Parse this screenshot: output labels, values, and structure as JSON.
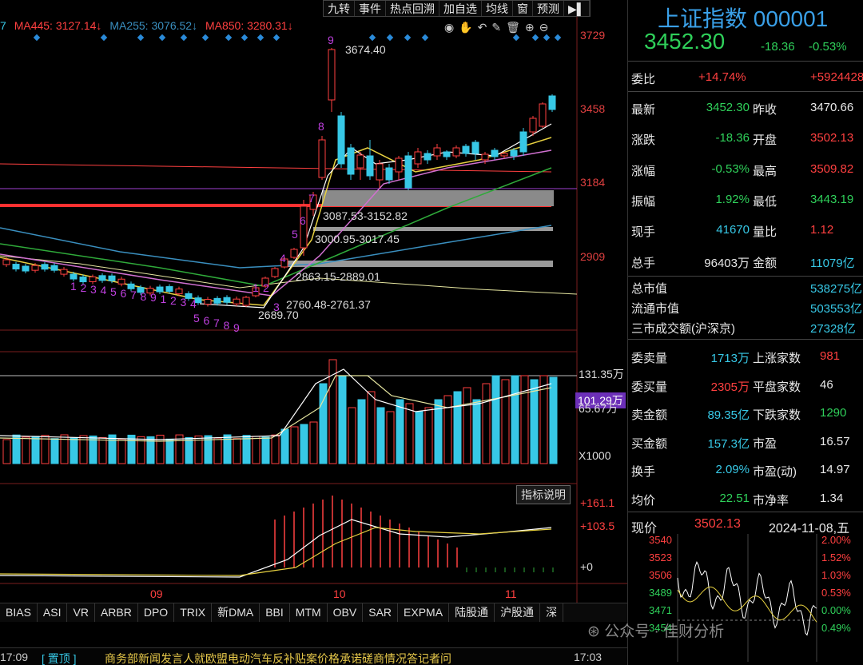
{
  "toolbar": {
    "items": [
      "九转",
      "事件",
      "热点回溯",
      "加自选",
      "均线",
      "窗",
      "预测",
      "▶▌"
    ]
  },
  "ma_legend": [
    {
      "text": "7",
      "color": "#37c8e6"
    },
    {
      "text": "MA445: 3127.14↓",
      "color": "#ff4040"
    },
    {
      "text": "MA255: 3076.52↓",
      "color": "#3a8fbf"
    },
    {
      "text": "MA850: 3280.31↓",
      "color": "#ff4040"
    }
  ],
  "price_axis": [
    "3729",
    "3458",
    "3184",
    "2909"
  ],
  "chart_annotations": {
    "high": "3674.40",
    "low": "2689.70",
    "gap1": "3087.53-3152.82",
    "gap2": "3000.95-3017.45",
    "gap3": "2863.15-2889.01",
    "gap4": "2760.48-2761.37"
  },
  "nine_turn": {
    "down1": [
      "1",
      "2",
      "3",
      "4",
      "5",
      "6",
      "7",
      "8",
      "9",
      "1",
      "2",
      "3",
      "4"
    ],
    "down2": [
      "5",
      "6",
      "7",
      "8",
      "9"
    ],
    "up": [
      "1",
      "2",
      "3",
      "4",
      "5",
      "6",
      "7",
      "8",
      "9"
    ]
  },
  "volume_axis": {
    "top": "131.35万",
    "mid": "101.29万",
    "low": "65.67万",
    "unit": "X1000"
  },
  "indicator": {
    "button": "指标说明",
    "axis": [
      "+161.1",
      "+103.5",
      "+0"
    ]
  },
  "x_axis": [
    "09",
    "10",
    "11"
  ],
  "bottom_tabs": [
    "BIAS",
    "ASI",
    "VR",
    "ARBR",
    "DPO",
    "TRIX",
    "新DMA",
    "BBI",
    "MTM",
    "OBV",
    "SAR",
    "EXPMA",
    "陆股通",
    "沪股通",
    "深"
  ],
  "status": {
    "time_left": "17:09",
    "tab": "[ 置顶 ]",
    "news": "商务部新闻发言人就欧盟电动汽车反补贴案价格承诺磋商情况答记者问",
    "time_right": "17:03"
  },
  "quote": {
    "title": "上证指数 000001",
    "price": "3452.30",
    "change": "-18.36",
    "change_pct": "-0.53%",
    "weibi_label": "委比",
    "weibi": "+14.74%",
    "weicha": "+5924428",
    "rows": [
      {
        "l1": "最新",
        "v1": "3452.30",
        "c1": "green",
        "l2": "昨收",
        "v2": "3470.66",
        "c2": "white"
      },
      {
        "l1": "涨跌",
        "v1": "-18.36",
        "c1": "green",
        "l2": "开盘",
        "v2": "3502.13",
        "c2": "red"
      },
      {
        "l1": "涨幅",
        "v1": "-0.53%",
        "c1": "green",
        "l2": "最高",
        "v2": "3509.82",
        "c2": "red"
      },
      {
        "l1": "振幅",
        "v1": "1.92%",
        "c1": "green",
        "l2": "最低",
        "v2": "3443.19",
        "c2": "green"
      },
      {
        "l1": "现手",
        "v1": "41670",
        "c1": "cyan",
        "l2": "量比",
        "v2": "1.12",
        "c2": "red"
      },
      {
        "l1": "总手",
        "v1": "96403万",
        "c1": "white",
        "l2": "金额",
        "v2": "11079亿",
        "c2": "cyan"
      }
    ],
    "caps": [
      {
        "l": "总市值",
        "v": "538275亿"
      },
      {
        "l": "流通市值",
        "v": "503553亿"
      },
      {
        "l": "三市成交额(沪深京)",
        "v": "27328亿"
      }
    ],
    "rows2": [
      {
        "l1": "委卖量",
        "v1": "1713万",
        "c1": "cyan",
        "l2": "上涨家数",
        "v2": "981",
        "c2": "red"
      },
      {
        "l1": "委买量",
        "v1": "2305万",
        "c1": "red",
        "l2": "平盘家数",
        "v2": "46",
        "c2": "white"
      },
      {
        "l1": "卖金额",
        "v1": "89.35亿",
        "c1": "cyan",
        "l2": "下跌家数",
        "v2": "1290",
        "c2": "green"
      },
      {
        "l1": "买金额",
        "v1": "157.3亿",
        "c1": "cyan",
        "l2": "市盈",
        "v2": "16.57",
        "c2": "white"
      },
      {
        "l1": "换手",
        "v1": "2.09%",
        "c1": "cyan",
        "l2": "市盈(动)",
        "v2": "14.97",
        "c2": "white"
      },
      {
        "l1": "均价",
        "v1": "22.51",
        "c1": "green",
        "l2": "市净率",
        "v2": "1.34",
        "c2": "white"
      }
    ],
    "mini": {
      "label": "现价",
      "price": "3502.13",
      "date": "2024-11-08,五",
      "left_axis": [
        "3540",
        "3523",
        "3506",
        "3489",
        "3471",
        "3454"
      ],
      "right_axis": [
        "2.00%",
        "1.52%",
        "1.03%",
        "0.53%",
        "0.00%",
        "0.49%"
      ]
    }
  },
  "watermark": "公众号 · 佳财分析"
}
